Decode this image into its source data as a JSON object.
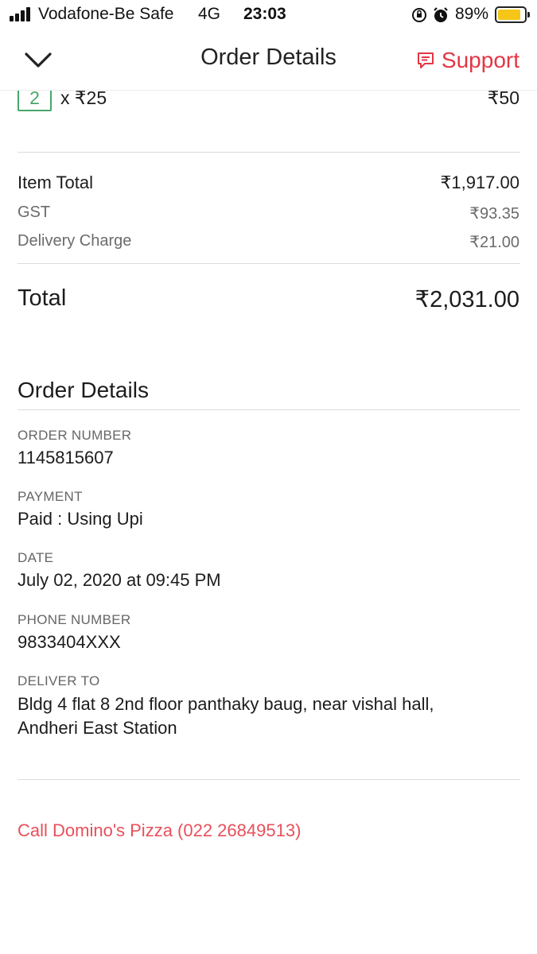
{
  "status_bar": {
    "carrier": "Vodafone-Be Safe",
    "network": "4G",
    "time": "23:03",
    "battery_percent": "89%",
    "battery_level": 0.89,
    "battery_color": "#f5c518"
  },
  "header": {
    "title": "Order Details",
    "support_label": "Support",
    "back_icon": "chevron-down-icon",
    "support_icon": "chat-bubble-icon",
    "accent_color": "#e23744"
  },
  "item": {
    "quantity": "2",
    "unit_price": "x ₹25",
    "line_total": "₹50"
  },
  "bill": {
    "item_total_label": "Item Total",
    "item_total_value": "₹1,917.00",
    "gst_label": "GST",
    "gst_value": "₹93.35",
    "delivery_label": "Delivery Charge",
    "delivery_value": "₹21.00",
    "total_label": "Total",
    "total_value": "₹2,031.00"
  },
  "order_details": {
    "heading": "Order Details",
    "order_number_label": "ORDER NUMBER",
    "order_number_value": "1145815607",
    "payment_label": "PAYMENT",
    "payment_value": "Paid : Using Upi",
    "date_label": "DATE",
    "date_value": "July 02, 2020 at 09:45 PM",
    "phone_label": "PHONE NUMBER",
    "phone_value": "9833404XXX",
    "deliver_label": "DELIVER TO",
    "deliver_line1": "Bldg 4 flat 8 2nd floor panthaky baug, near vishal hall,",
    "deliver_line2": "Andheri East Station"
  },
  "footer": {
    "call_link": "Call Domino's Pizza (022 26849513)",
    "link_color": "#e8505b"
  }
}
